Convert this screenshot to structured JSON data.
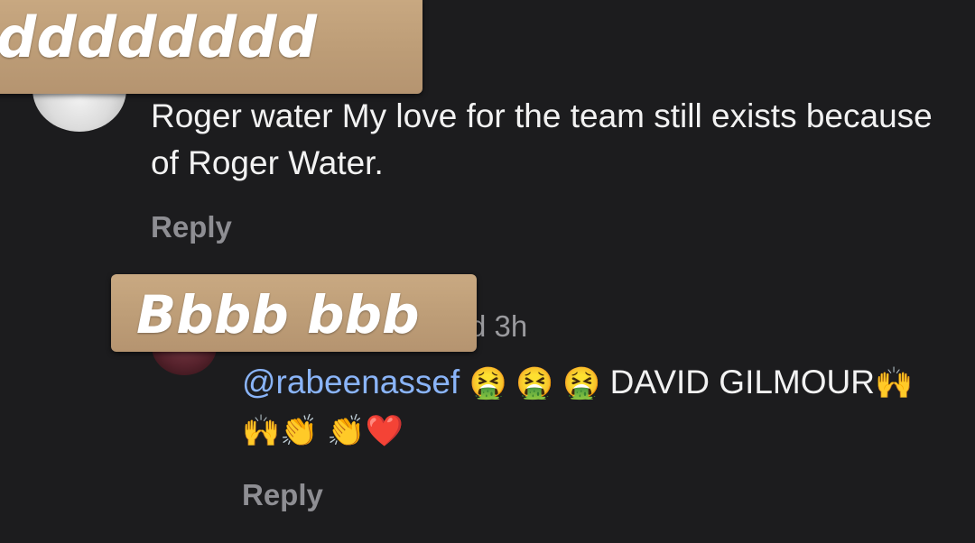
{
  "stickers": {
    "top_text": "dddddddd",
    "mid_text": "Bbbb bbb"
  },
  "comments": [
    {
      "text": "Roger water My love for the team still exists because of Roger Water.",
      "reply_label": "Reply"
    },
    {
      "username_fragment": "d",
      "time": "3h",
      "mention": "@rabeenassef",
      "emojis_before": "🤮 🤮 🤮",
      "text_after": " DAVID GILMOUR",
      "emojis_after": "🙌🙌👏 👏❤️",
      "reply_label": "Reply"
    }
  ],
  "colors": {
    "background": "#1c1c1e",
    "text": "#f2f2f2",
    "secondary_text": "#8e8e93",
    "mention": "#8ab4f8",
    "sticker": "#c0a07a"
  }
}
